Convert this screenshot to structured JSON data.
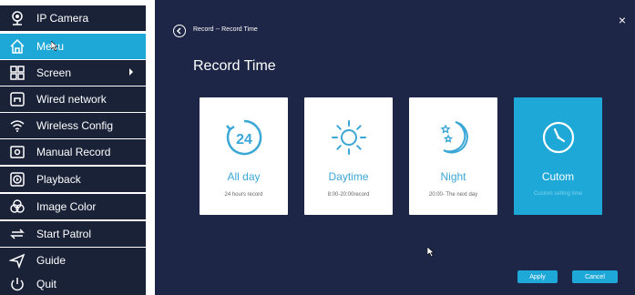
{
  "sidebar": {
    "items": [
      {
        "label": "IP Camera",
        "icon": "ip-camera-icon"
      },
      {
        "label": "Menu",
        "icon": "home-icon",
        "active": true
      },
      {
        "label": "Screen",
        "icon": "screen-layout-icon",
        "has_submenu": true
      },
      {
        "label": "Wired network",
        "icon": "wired-network-icon"
      },
      {
        "label": "Wireless Config",
        "icon": "wifi-icon"
      },
      {
        "label": "Manual Record",
        "icon": "record-icon"
      },
      {
        "label": "Playback",
        "icon": "playback-icon"
      },
      {
        "label": "Image Color",
        "icon": "color-icon"
      },
      {
        "label": "Start Patrol",
        "icon": "patrol-icon"
      },
      {
        "label": "Guide",
        "icon": "guide-icon"
      },
      {
        "label": "Quit",
        "icon": "power-icon"
      }
    ]
  },
  "dialog": {
    "breadcrumb": "Record -- Record Time",
    "title": "Record Time",
    "close": "×",
    "cards": [
      {
        "icon": "24-hour-icon",
        "icon_text": "24",
        "title": "All day",
        "subtitle": "24 hours record"
      },
      {
        "icon": "sun-icon",
        "title": "Daytime",
        "subtitle": "8:00-20:00record"
      },
      {
        "icon": "moon-icon",
        "title": "Night",
        "subtitle": "20:00- The next day"
      },
      {
        "icon": "clock-icon",
        "title": "Cutom",
        "subtitle": "Custom setting time",
        "selected": true
      }
    ],
    "apply_label": "Apply",
    "cancel_label": "Cancel"
  },
  "colors": {
    "sidebar_bg": "#1a2238",
    "accent": "#1ea8d8",
    "dialog_bg": "#1d2646",
    "card_title": "#3ba7d6"
  }
}
